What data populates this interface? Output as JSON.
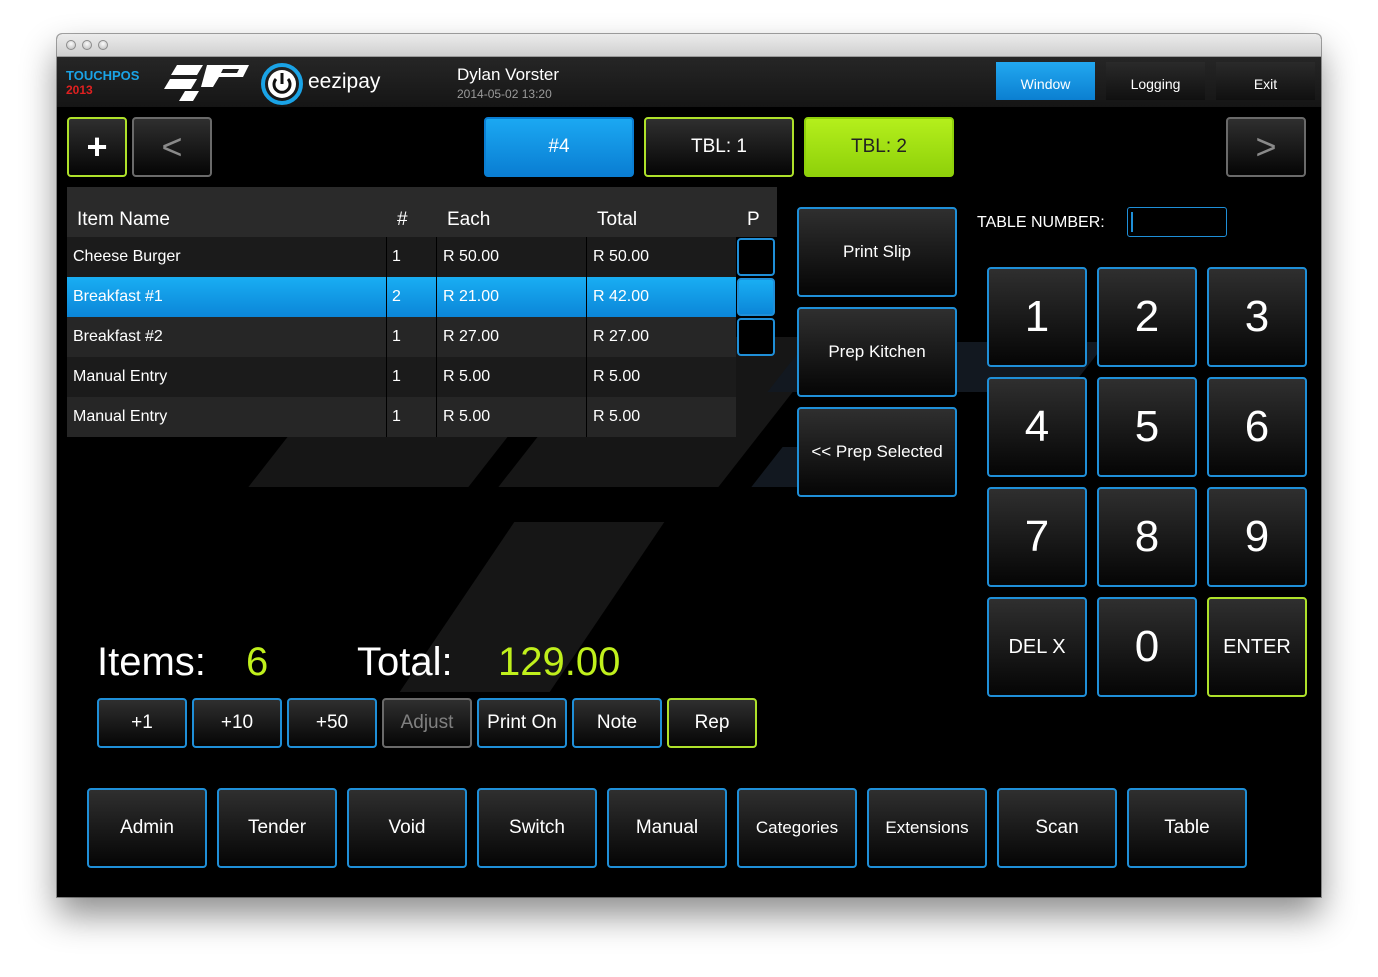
{
  "window": {
    "traffic_lights": [
      "close",
      "minimize",
      "zoom"
    ]
  },
  "brand": {
    "name": "TOUCHPOS",
    "year": "2013",
    "partner": "eezipay",
    "colors": {
      "accent_blue": "#1f8fd8",
      "accent_green": "#aee12a",
      "brand_red": "#e02020"
    }
  },
  "user": {
    "name": "Dylan Vorster",
    "datetime": "2014-05-02 13:20"
  },
  "header_buttons": {
    "window": "Window",
    "logging": "Logging",
    "exit": "Exit"
  },
  "nav": {
    "add": "+",
    "prev": "<",
    "next": ">"
  },
  "order_tabs": [
    {
      "label": "#4",
      "state": "active-blue"
    },
    {
      "label": "TBL: 1",
      "state": "normal"
    },
    {
      "label": "TBL: 2",
      "state": "active-green"
    }
  ],
  "order_table": {
    "columns": {
      "name": "Item Name",
      "qty": "#",
      "each": "Each",
      "total": "Total",
      "p": "P"
    },
    "rows": [
      {
        "name": "Cheese Burger",
        "qty": "1",
        "each": "R 50.00",
        "total": "R 50.00",
        "p": "empty"
      },
      {
        "name": "Breakfast #1",
        "qty": "2",
        "each": "R 21.00",
        "total": "R 42.00",
        "p": "checked",
        "selected": true
      },
      {
        "name": "Breakfast #2",
        "qty": "1",
        "each": "R 27.00",
        "total": "R 27.00",
        "p": "empty"
      },
      {
        "name": "Manual Entry",
        "qty": "1",
        "each": "R 5.00",
        "total": "R 5.00"
      },
      {
        "name": "Manual Entry",
        "qty": "1",
        "each": "R 5.00",
        "total": "R 5.00"
      }
    ]
  },
  "actions": {
    "print_slip": "Print Slip",
    "prep_kitchen": "Prep Kitchen",
    "prep_selected": "<< Prep Selected"
  },
  "summary": {
    "items_label": "Items:",
    "items_value": "6",
    "total_label": "Total:",
    "total_value": "129.00"
  },
  "qty_buttons": {
    "plus1": "+1",
    "plus10": "+10",
    "plus50": "+50",
    "adjust": "Adjust",
    "print_on": "Print On",
    "note": "Note",
    "rep": "Rep"
  },
  "keypad": {
    "label": "TABLE NUMBER:",
    "value": "",
    "keys": [
      "1",
      "2",
      "3",
      "4",
      "5",
      "6",
      "7",
      "8",
      "9"
    ],
    "del": "DEL X",
    "zero": "0",
    "enter": "ENTER"
  },
  "bottom_bar": {
    "admin": "Admin",
    "tender": "Tender",
    "void": "Void",
    "switch": "Switch",
    "manual": "Manual",
    "categories": "Categories",
    "extensions": "Extensions",
    "scan": "Scan",
    "table": "Table"
  }
}
